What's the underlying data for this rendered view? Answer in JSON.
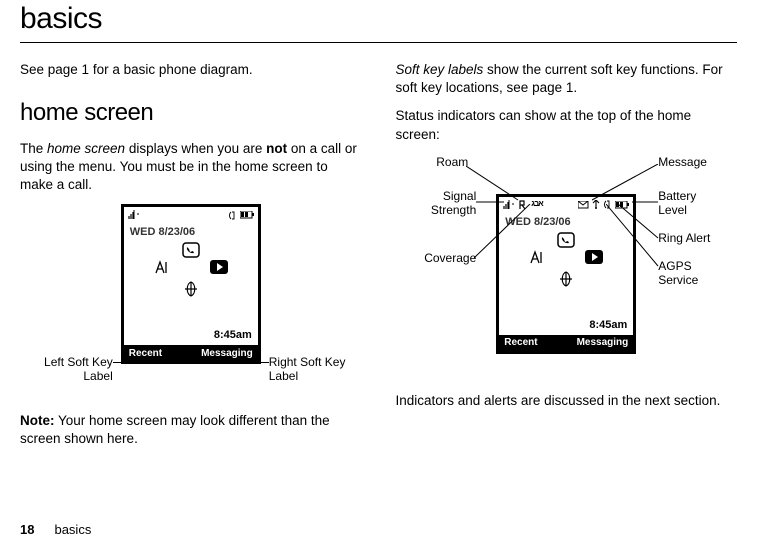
{
  "page_title": "basics",
  "intro": "See page 1 for a basic phone diagram.",
  "section_heading": "home screen",
  "col1": {
    "p1_a": "The ",
    "p1_i": "home screen",
    "p1_b": " displays when you are ",
    "p1_bold": "not",
    "p1_c": " on a call or using the menu. You must be in the home screen to make a call.",
    "note_label": "Note:",
    "note_text": " Your home screen may look different than the screen shown here."
  },
  "col2": {
    "p1_i": "Soft key labels",
    "p1_a": " show the current soft key functions. For soft key locations, see page 1.",
    "p2": "Status indicators can show at the top of the home screen:",
    "p3": "Indicators and alerts are discussed in the next section."
  },
  "phone": {
    "date": "WED 8/23/06",
    "time": "8:45am",
    "soft_left": "Recent",
    "soft_right": "Messaging"
  },
  "labels_fig1": {
    "left": "Left Soft Key Label",
    "right": "Right Soft Key Label"
  },
  "labels_fig2": {
    "roam": "Roam",
    "signal": "Signal Strength",
    "coverage": "Coverage",
    "message": "Message",
    "battery": "Battery Level",
    "ring": "Ring Alert",
    "agps": "AGPS Service"
  },
  "footer": {
    "page_number": "18",
    "section": "basics"
  }
}
